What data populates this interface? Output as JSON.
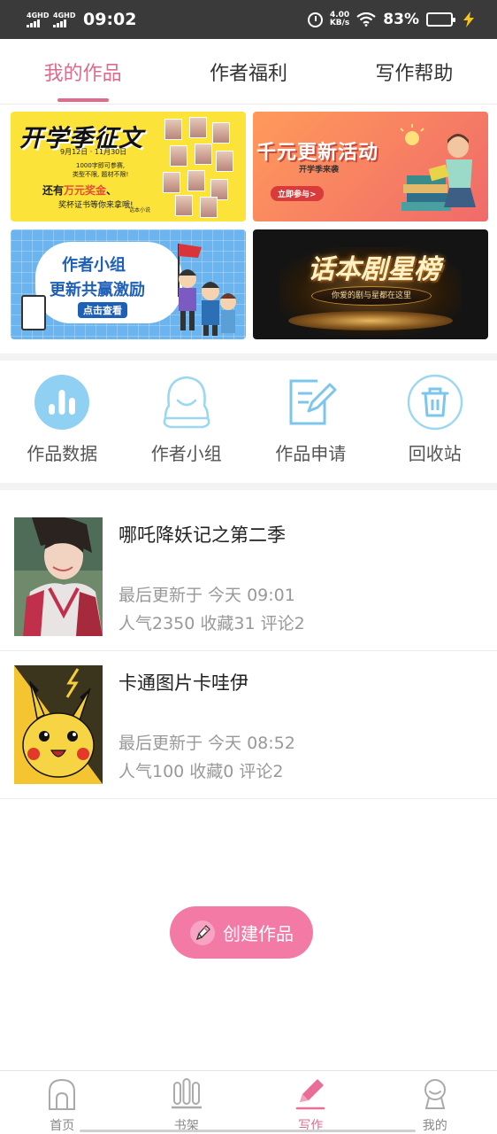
{
  "status_bar": {
    "sim1": "4GHD",
    "sim2": "4GHD",
    "time": "09:02",
    "net_speed": "4.00",
    "net_unit": "KB/s",
    "battery": "83%",
    "battery_level": 0.83,
    "battery_color": "#4cd964"
  },
  "tabs": [
    {
      "label": "我的作品",
      "active": true
    },
    {
      "label": "作者福利",
      "active": false
    },
    {
      "label": "写作帮助",
      "active": false
    }
  ],
  "banners": {
    "b1": {
      "title": "开学季征文",
      "date": "9月12日 · 11月30日",
      "small1": "1000字即可参赛,",
      "small2": "类型不限, 题材不限!",
      "prize_prefix": "还有",
      "prize_highlight": "万元奖金",
      "prize_suffix": "、",
      "trophy": "奖杯证书等你来拿哦!",
      "brand": "话本小说"
    },
    "b2": {
      "title": "千元更新活动",
      "sub": "开学季来袭",
      "button": "立即参与>"
    },
    "b3": {
      "line1": "作者小组",
      "line2": "更新共赢激励",
      "button": "点击查看"
    },
    "b4": {
      "title": "话本剧星榜",
      "plate": "你爱的剧与星都在这里"
    }
  },
  "quick_actions": [
    {
      "label": "作品数据",
      "icon": "bar-chart-icon"
    },
    {
      "label": "作者小组",
      "icon": "author-group-icon"
    },
    {
      "label": "作品申请",
      "icon": "edit-document-icon"
    },
    {
      "label": "回收站",
      "icon": "trash-icon"
    }
  ],
  "works": [
    {
      "title": "哪吒降妖记之第二季",
      "updated": "最后更新于 今天 09:01",
      "stats": "人气2350 收藏31 评论2"
    },
    {
      "title": "卡通图片卡哇伊",
      "updated": "最后更新于 今天 08:52",
      "stats": "人气100 收藏0 评论2"
    }
  ],
  "create_button": {
    "label": "创建作品",
    "color": "#f47aa6"
  },
  "bottom_nav": [
    {
      "label": "首页",
      "icon": "home-icon",
      "active": false
    },
    {
      "label": "书架",
      "icon": "bookshelf-icon",
      "active": false
    },
    {
      "label": "写作",
      "icon": "pen-icon",
      "active": true
    },
    {
      "label": "我的",
      "icon": "profile-icon",
      "active": false
    }
  ],
  "colors": {
    "accent": "#e06a8c",
    "muted": "#999999"
  }
}
